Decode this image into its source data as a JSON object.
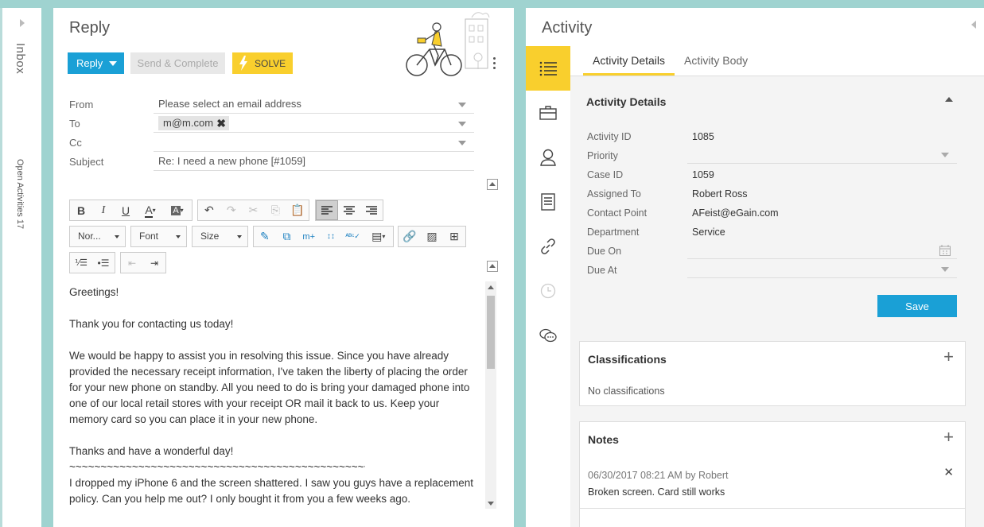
{
  "rail": {
    "inbox_label": "Inbox",
    "open_activities_label": "Open Activities 17"
  },
  "reply": {
    "title": "Reply",
    "reply_button": "Reply",
    "send_complete_button": "Send & Complete",
    "solve_button": "SOLVE",
    "from_label": "From",
    "from_placeholder": "Please select an email address",
    "to_label": "To",
    "to_chip": "m@m.com",
    "cc_label": "Cc",
    "subject_label": "Subject",
    "subject_value": "Re: I need a new phone [#1059]",
    "toolbar": {
      "format_select": "Nor...",
      "font_select": "Font",
      "size_select": "Size"
    },
    "body": [
      "Greetings!",
      "Thank you for contacting us today!",
      "We would be happy to assist you in resolving this issue. Since you have already provided the necessary receipt information, I've taken the liberty of placing the order for your new phone on standby. All you need to do is bring your damaged phone into one of our local retail stores with your receipt OR mail it back to us. Keep your memory card so you can place it in your new phone.",
      "Thanks and have a wonderful day!",
      "~~~~~~~~~~~~~~~~~~~~~~~~~~~~~~~~~~~~~~~~~~~~~~~~~~~~",
      "I dropped my iPhone 6 and the screen shattered. I saw you guys have a replacement policy. Can you help me out? I only bought it from you a few weeks ago."
    ]
  },
  "activity": {
    "title": "Activity",
    "tabs": [
      "Activity Details",
      "Activity Body"
    ],
    "section_title": "Activity Details",
    "fields": [
      {
        "label": "Activity ID",
        "value": "1085"
      },
      {
        "label": "Priority",
        "value": ""
      },
      {
        "label": "Case ID",
        "value": "1059"
      },
      {
        "label": "Assigned To",
        "value": "Robert Ross"
      },
      {
        "label": "Contact Point",
        "value": "AFeist@eGain.com"
      },
      {
        "label": "Department",
        "value": "Service"
      },
      {
        "label": "Due On",
        "value": ""
      },
      {
        "label": "Due At",
        "value": ""
      }
    ],
    "save_button": "Save",
    "classifications": {
      "title": "Classifications",
      "empty_text": "No classifications"
    },
    "notes": {
      "title": "Notes",
      "items": [
        {
          "meta": "06/30/2017 08:21 AM by Robert",
          "text": "Broken screen. Card still works"
        }
      ]
    }
  }
}
